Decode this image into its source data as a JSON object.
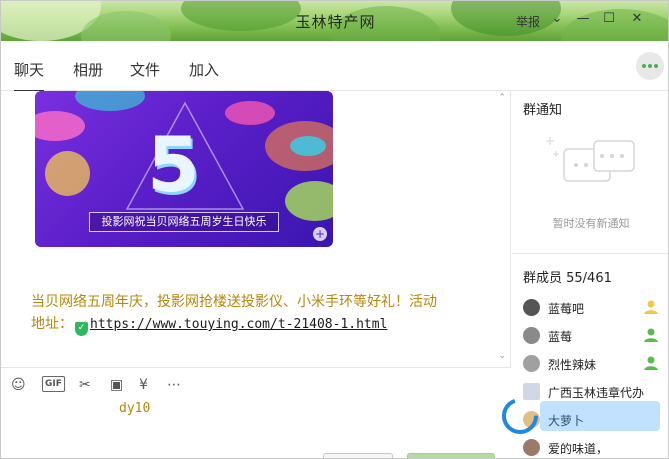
{
  "window": {
    "title": "玉林特产网",
    "report_label": "举报",
    "buttons": [
      "chevron-down",
      "minimize",
      "maximize",
      "close"
    ]
  },
  "tabs": [
    {
      "label": "聊天",
      "active": true
    },
    {
      "label": "相册",
      "active": false
    },
    {
      "label": "文件",
      "active": false
    },
    {
      "label": "加入",
      "active": false
    }
  ],
  "message": {
    "banner_number": "5",
    "banner_caption": "投影网祝当贝网络五周岁生日快乐",
    "text": "当贝网络五周年庆，投影网抢楼送投影仪、小米手环等好礼！活动",
    "text_prefix": "地址：",
    "link": "https://www.touying.com/t-21408-1.html",
    "colors": {
      "text": "#b8860b",
      "banner": "#5b1fc9"
    }
  },
  "toolbar": {
    "icons": [
      "emoji-icon",
      "gif-icon",
      "scissors-icon",
      "image-icon",
      "red-packet-icon",
      "more-icon"
    ],
    "gif_label": "GIF"
  },
  "input": {
    "value": "dy10"
  },
  "sidebar": {
    "notice_title": "群通知",
    "notice_empty": "暂时没有新通知",
    "members_title": "群成员 55/461",
    "members": [
      {
        "name": "蓝莓吧",
        "role": "owner-icon"
      },
      {
        "name": "蓝莓",
        "role": "admin-icon"
      },
      {
        "name": "烈性辣妹",
        "role": "admin-icon"
      },
      {
        "name": "广西玉林违章代办",
        "role": "member-icon"
      },
      {
        "name": "大萝卜",
        "role": ""
      },
      {
        "name": "爱的味道，",
        "role": ""
      }
    ]
  }
}
